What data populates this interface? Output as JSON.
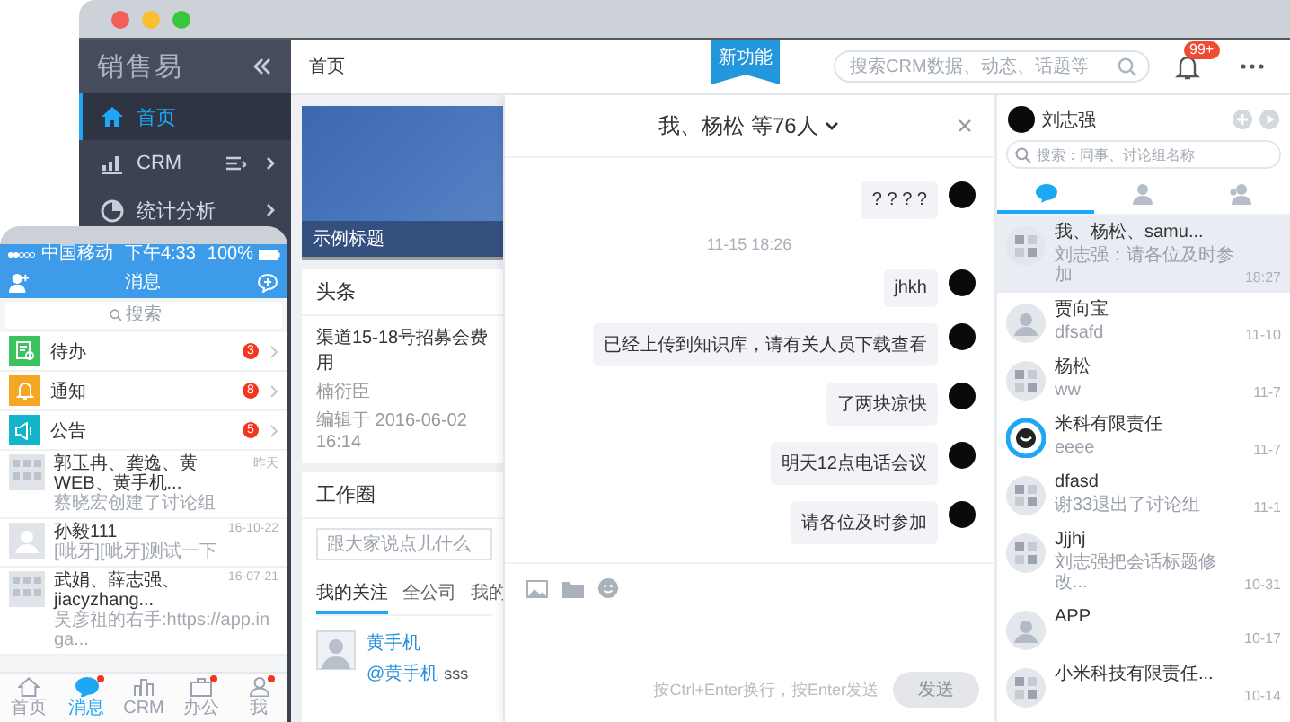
{
  "desktop": {
    "logo": "销售易",
    "sidebar": [
      {
        "label": "首页",
        "selected": true
      },
      {
        "label": "CRM",
        "selected": false
      },
      {
        "label": "统计分析",
        "selected": false
      }
    ],
    "breadcrumb": "首页",
    "ribbon": "新功能",
    "search": {
      "placeholder": "搜索CRM数据、动态、话题等"
    },
    "notifications": "99+",
    "banner": {
      "caption": "示例标题"
    },
    "headline": {
      "title": "头条",
      "item": "渠道15-18号招募会费用",
      "author": "楠衍臣",
      "edited": "编辑于 2016-06-02 16:14"
    },
    "work_circle": {
      "title": "工作圈",
      "placeholder": "跟大家说点儿什么",
      "tabs": [
        {
          "label": "我的关注",
          "selected": true
        },
        {
          "label": "全公司",
          "selected": false
        },
        {
          "label": "我的",
          "selected": false
        }
      ],
      "post": {
        "author": "黄手机",
        "mention": "@黄手机",
        "text": "sss"
      }
    },
    "chat": {
      "title": "我、杨松 等76人",
      "messages": [
        {
          "kind": "bubble",
          "text": "? ? ? ?"
        },
        {
          "kind": "time",
          "text": "11-15 18:26"
        },
        {
          "kind": "bubble",
          "text": "jhkh"
        },
        {
          "kind": "bubble",
          "text": "已经上传到知识库，请有关人员下载查看"
        },
        {
          "kind": "bubble",
          "text": "了两块凉快"
        },
        {
          "kind": "bubble",
          "text": "明天12点电话会议"
        },
        {
          "kind": "bubble",
          "text": "请各位及时参加"
        }
      ],
      "hint": "按Ctrl+Enter换行，按Enter发送",
      "send": {
        "label": "发送",
        "disabled": true
      }
    },
    "contacts": {
      "user": "刘志强",
      "search": {
        "placeholder": "搜索：同事、讨论组名称"
      },
      "tabs": [
        {
          "selected": true
        },
        {
          "selected": false
        },
        {
          "selected": false
        }
      ],
      "conversations": [
        {
          "kind": "group",
          "name": "我、杨松、samu...",
          "preview": "刘志强：请各位及时参加",
          "time": "18:27",
          "selected": true
        },
        {
          "kind": "person",
          "name": "贾向宝",
          "preview": "dfsafd",
          "time": "11-10",
          "selected": false
        },
        {
          "kind": "group",
          "name": "杨松",
          "preview": "ww",
          "time": "11-7",
          "selected": false
        },
        {
          "kind": "ring",
          "name": "米科有限责任",
          "preview": "eeee",
          "time": "11-7",
          "selected": false
        },
        {
          "kind": "group",
          "name": "dfasd",
          "preview": "谢33退出了讨论组",
          "time": "11-1",
          "selected": false
        },
        {
          "kind": "group",
          "name": "Jjjhj",
          "preview": "刘志强把会话标题修改...",
          "time": "10-31",
          "selected": false
        },
        {
          "kind": "person",
          "name": "APP",
          "time": "10-17",
          "selected": false
        },
        {
          "kind": "group",
          "name": "小米科技有限责任...",
          "time": "10-14",
          "selected": false
        }
      ]
    }
  },
  "phone": {
    "status": {
      "carrier": "中国移动",
      "time": "下午4:33",
      "battery": "100%"
    },
    "title": "消息",
    "search": {
      "placeholder": "搜索"
    },
    "apps": [
      {
        "label": "待办",
        "color": "#3cc35f",
        "badge": "3"
      },
      {
        "label": "通知",
        "color": "#f5a623",
        "badge": "8"
      },
      {
        "label": "公告",
        "color": "#12b5c9",
        "badge": "5"
      }
    ],
    "chats": [
      {
        "kind": "group",
        "name": "郭玉冉、龚逸、黄WEB、黄手机...",
        "preview": "蔡晓宏创建了讨论组",
        "time": "昨天"
      },
      {
        "kind": "person",
        "name": "孙毅111",
        "preview": "[呲牙][呲牙]测试一下",
        "time": "16-10-22"
      },
      {
        "kind": "group",
        "name": "武娟、薛志强、jiacyzhang...",
        "preview": "吴彦祖的右手:https://app.inga...",
        "time": "16-07-21"
      }
    ],
    "tabs": [
      {
        "label": "首页",
        "selected": false,
        "dot": false
      },
      {
        "label": "消息",
        "selected": true,
        "dot": true
      },
      {
        "label": "CRM",
        "selected": false,
        "dot": false
      },
      {
        "label": "办公",
        "selected": false,
        "dot": true
      },
      {
        "label": "我",
        "selected": false,
        "dot": true
      }
    ]
  }
}
